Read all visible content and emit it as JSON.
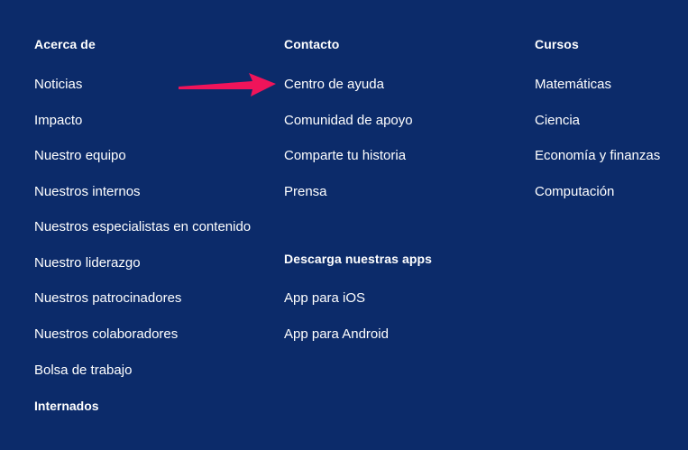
{
  "columns": [
    {
      "heading": "Acerca de",
      "links": [
        "Noticias",
        "Impacto",
        "Nuestro equipo",
        "Nuestros internos",
        "Nuestros especialistas en contenido",
        "Nuestro liderazgo",
        "Nuestros patrocinadores",
        "Nuestros colaboradores",
        "Bolsa de trabajo",
        "Internados"
      ]
    },
    {
      "heading": "Contacto",
      "links": [
        "Centro de ayuda",
        "Comunidad de apoyo",
        "Comparte tu historia",
        "Prensa"
      ],
      "apps_heading": "Descarga nuestras apps",
      "apps_links": [
        "App para iOS",
        "App para Android"
      ]
    },
    {
      "heading": "Cursos",
      "links": [
        "Matemáticas",
        "Ciencia",
        "Economía y finanzas",
        "Computación"
      ]
    }
  ],
  "annotation": {
    "icon": "arrow-right-icon",
    "color": "#f0145a"
  },
  "colors": {
    "background": "#0c2b6a",
    "text": "#ffffff"
  }
}
